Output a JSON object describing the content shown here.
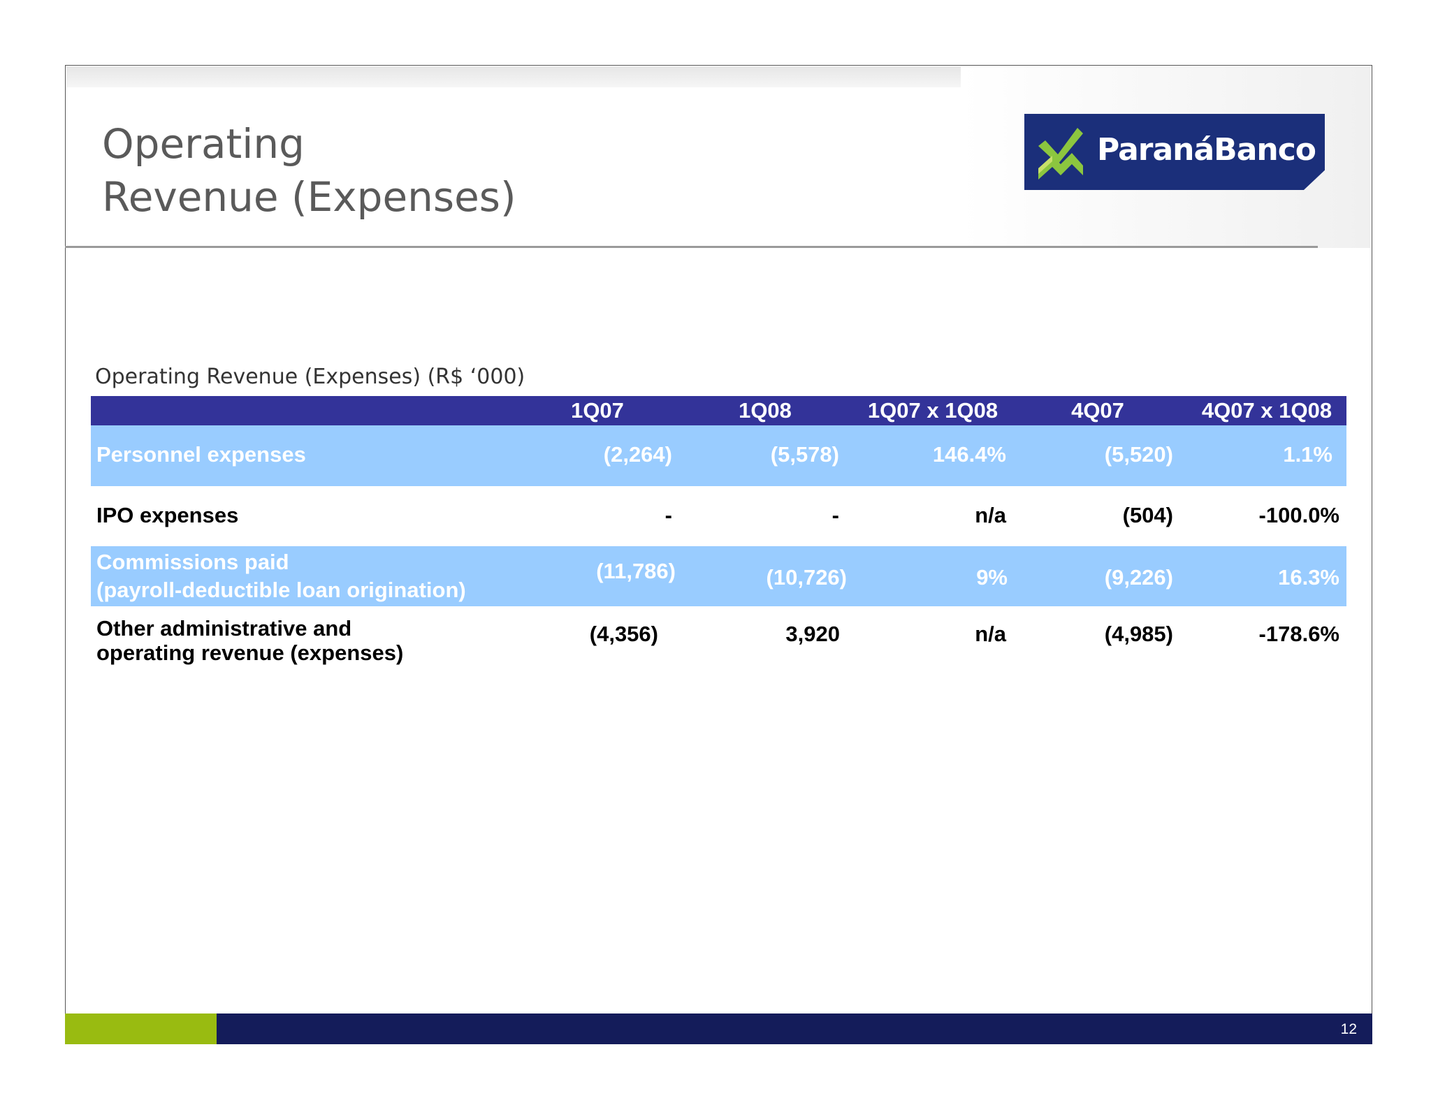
{
  "title": {
    "line1": "Operating",
    "line2": "Revenue (Expenses)"
  },
  "logo": {
    "text": "ParanáBanco"
  },
  "table": {
    "caption": "Operating Revenue (Expenses) (R$ ‘000)",
    "headers": [
      "1Q07",
      "1Q08",
      "1Q07 x 1Q08",
      "4Q07",
      "4Q07 x 1Q08"
    ],
    "rows": [
      {
        "label1": "Personnel expenses",
        "label2": "",
        "values": [
          "(2,264)",
          "(5,578)",
          "146.4%",
          "(5,520)",
          "1.1%"
        ]
      },
      {
        "label1": "IPO expenses",
        "label2": "",
        "values": [
          "-",
          "-",
          "n/a",
          "(504)",
          "-100.0%"
        ]
      },
      {
        "label1": "Commissions paid",
        "label2": "(payroll-deductible loan origination)",
        "values": [
          "(11,786)",
          "(10,726)",
          "9%",
          "(9,226)",
          "16.3%"
        ]
      },
      {
        "label1": "Other administrative and",
        "label2": "operating revenue (expenses)",
        "values": [
          "(4,356)",
          "3,920",
          "n/a",
          "(4,985)",
          "-178.6%"
        ]
      }
    ]
  },
  "footer": {
    "page_number": "12"
  },
  "colors": {
    "header": "#333399",
    "band": "#99ccff",
    "navy": "#141c5a",
    "green": "#99bb11"
  }
}
